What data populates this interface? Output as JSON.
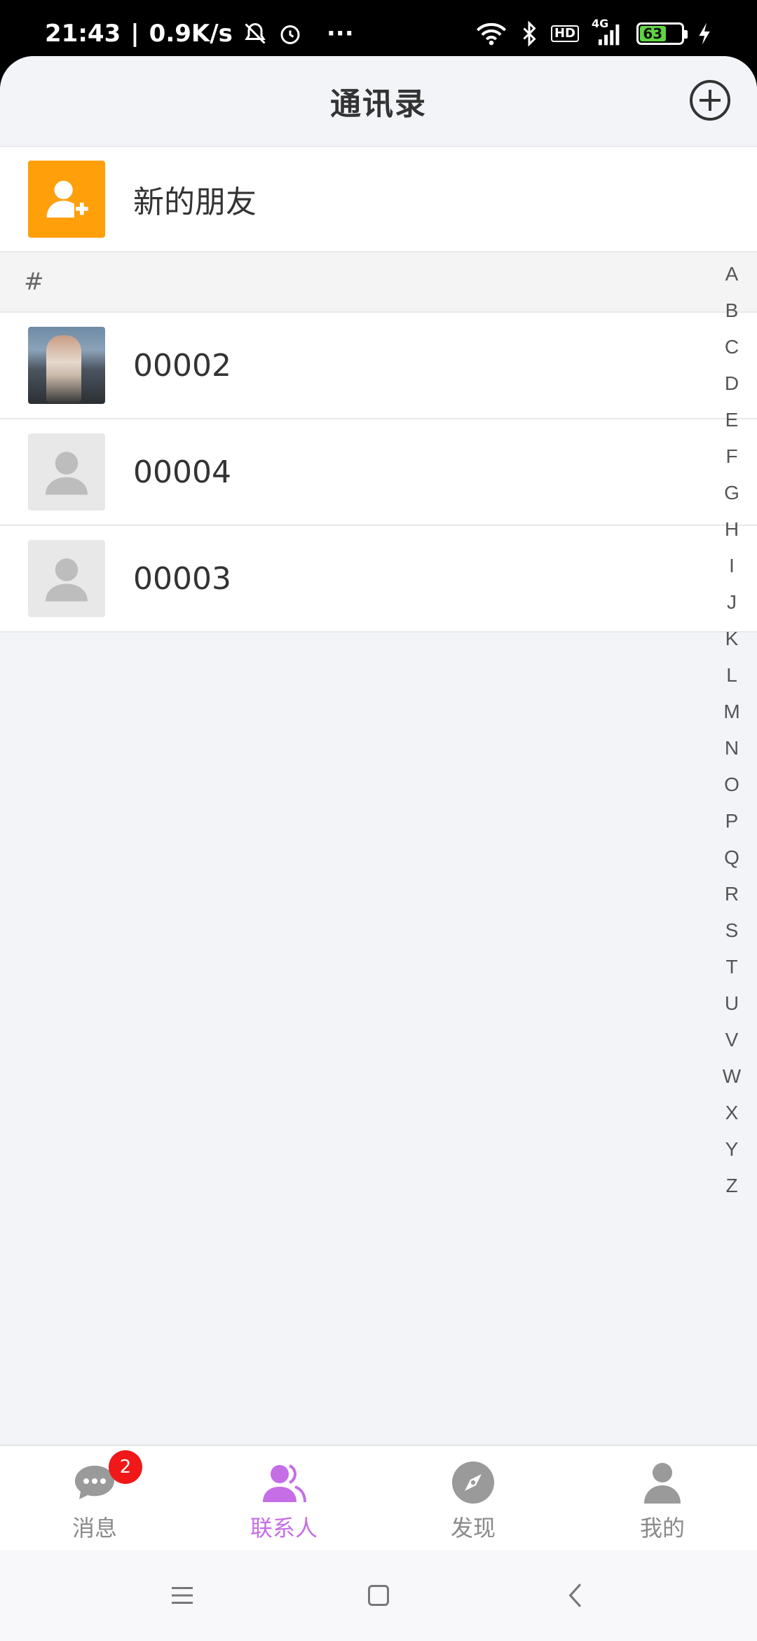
{
  "status_bar": {
    "time": "21:43",
    "speed": "0.9K/s",
    "more": "···",
    "network": "4G",
    "hd": "HD",
    "battery": "63",
    "battery_level": 0.63
  },
  "header": {
    "title": "通讯录"
  },
  "new_friend": {
    "label": "新的朋友"
  },
  "section": {
    "label": "#"
  },
  "contacts": [
    {
      "name": "00002",
      "avatar": "photo"
    },
    {
      "name": "00004",
      "avatar": "default-person-icon"
    },
    {
      "name": "00003",
      "avatar": "default-person-icon"
    }
  ],
  "alphabet": [
    "A",
    "B",
    "C",
    "D",
    "E",
    "F",
    "G",
    "H",
    "I",
    "J",
    "K",
    "L",
    "M",
    "N",
    "O",
    "P",
    "Q",
    "R",
    "S",
    "T",
    "U",
    "V",
    "W",
    "X",
    "Y",
    "Z"
  ],
  "tabs": [
    {
      "label": "消息",
      "icon": "chat-icon",
      "badge": "2",
      "active": false
    },
    {
      "label": "联系人",
      "icon": "contacts-icon",
      "active": true
    },
    {
      "label": "发现",
      "icon": "compass-icon",
      "active": false
    },
    {
      "label": "我的",
      "icon": "person-icon",
      "active": false
    }
  ],
  "colors": {
    "accent": "#c56ee6",
    "new_friend_bg": "#ff9f0a",
    "badge": "#f01818"
  }
}
